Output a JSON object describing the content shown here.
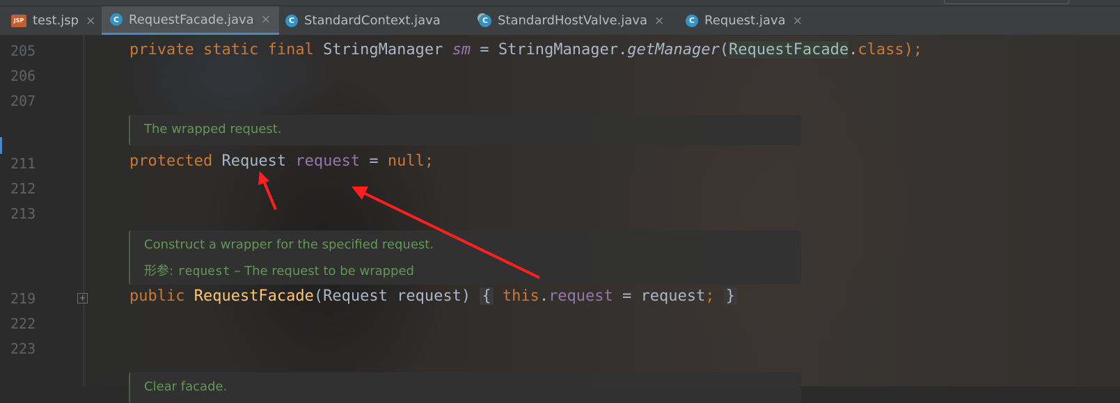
{
  "tabs": [
    {
      "label": "test.jsp",
      "icon": "jsp-file-icon",
      "icon_text": "JSP",
      "active": false
    },
    {
      "label": "RequestFacade.java",
      "icon": "java-class-icon",
      "icon_text": "C",
      "active": true
    },
    {
      "label": "StandardContext.java",
      "icon": "java-class-icon",
      "icon_text": "C",
      "active": false
    },
    {
      "label": "StandardHostValve.java",
      "icon": "java-class-icon",
      "icon_text": "C",
      "active": false
    },
    {
      "label": "Request.java",
      "icon": "java-class-icon",
      "icon_text": "C",
      "active": false
    }
  ],
  "tab_close_glyph": "×",
  "line_numbers": [
    "205",
    "206",
    "207",
    "211",
    "212",
    "213",
    "219",
    "222",
    "223"
  ],
  "code": {
    "l205": {
      "kw": "private static final ",
      "type": "StringManager ",
      "var": "sm",
      "mid": " = StringManager.",
      "method": "getManager",
      "open": "(",
      "cls": "RequestFacade",
      "dot": ".",
      "kwclass": "class",
      "end": ");"
    },
    "l211": {
      "kw": "protected ",
      "type": "Request ",
      "var": "request",
      "mid": " = ",
      "nul": "null;"
    },
    "l219": {
      "kw": "public ",
      "ctor": "RequestFacade",
      "params": "(Request request) ",
      "lbrace": "{",
      "this": " this",
      "dot": ".",
      "field": "request",
      "rest": " = request",
      "semi": ";",
      "rbrace": "}"
    }
  },
  "docs": {
    "wrapped": "The wrapped request.",
    "construct": "Construct a wrapper for the specified request.",
    "param_label": "形参:",
    "param_name": "request",
    "param_desc": " – The request to be wrapped",
    "clear": "Clear facade."
  },
  "fold_glyph": "+",
  "colors": {
    "annotation_arrow": "#ff1f1f",
    "accent": "#4a88c7",
    "keyword": "#cc7832",
    "doc_comment": "#629755"
  }
}
